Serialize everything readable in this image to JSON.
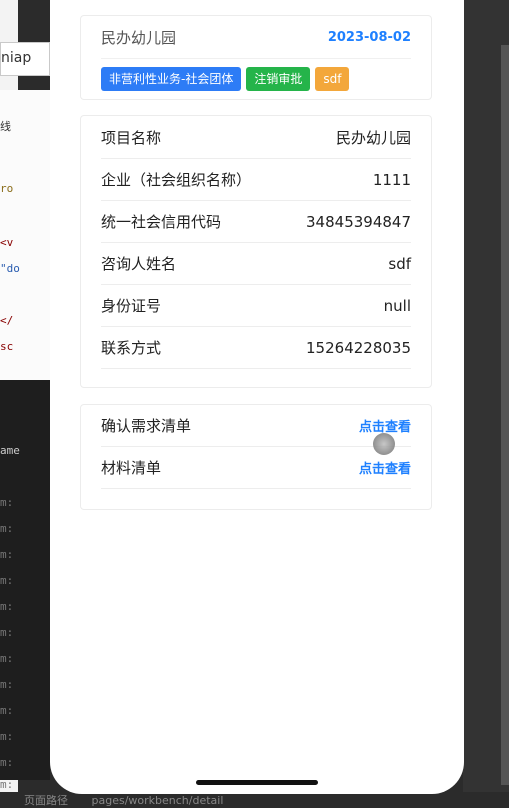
{
  "ide": {
    "input_text": "niap",
    "snippets": [
      "线",
      "ro",
      "<v",
      "\"do",
      "</",
      "sc",
      "ame",
      "m:",
      "m:",
      "m:",
      "m:",
      "m:",
      "m:",
      "m:",
      "m:",
      "m:",
      "m:",
      "m:",
      "m:"
    ],
    "status_left": "页面路径",
    "status_path": "pages/workbench/detail"
  },
  "header_card": {
    "title": "民办幼儿园",
    "date": "2023-08-02",
    "tags": [
      {
        "label": "非营利性业务-社会团体",
        "color": "#2d7cf6"
      },
      {
        "label": "注销审批",
        "color": "#25b44a"
      },
      {
        "label": "sdf",
        "color": "#f3a73b"
      }
    ]
  },
  "details": [
    {
      "label": "项目名称",
      "value": "民办幼儿园"
    },
    {
      "label": "企业（社会组织名称）",
      "value": "1111"
    },
    {
      "label": "统一社会信用代码",
      "value": "34845394847"
    },
    {
      "label": "咨询人姓名",
      "value": "sdf"
    },
    {
      "label": "身份证号",
      "value": "null"
    },
    {
      "label": "联系方式",
      "value": "15264228035"
    }
  ],
  "materials": [
    {
      "label": "确认需求清单",
      "action": "点击查看"
    },
    {
      "label": "材料清单",
      "action": "点击查看"
    }
  ]
}
